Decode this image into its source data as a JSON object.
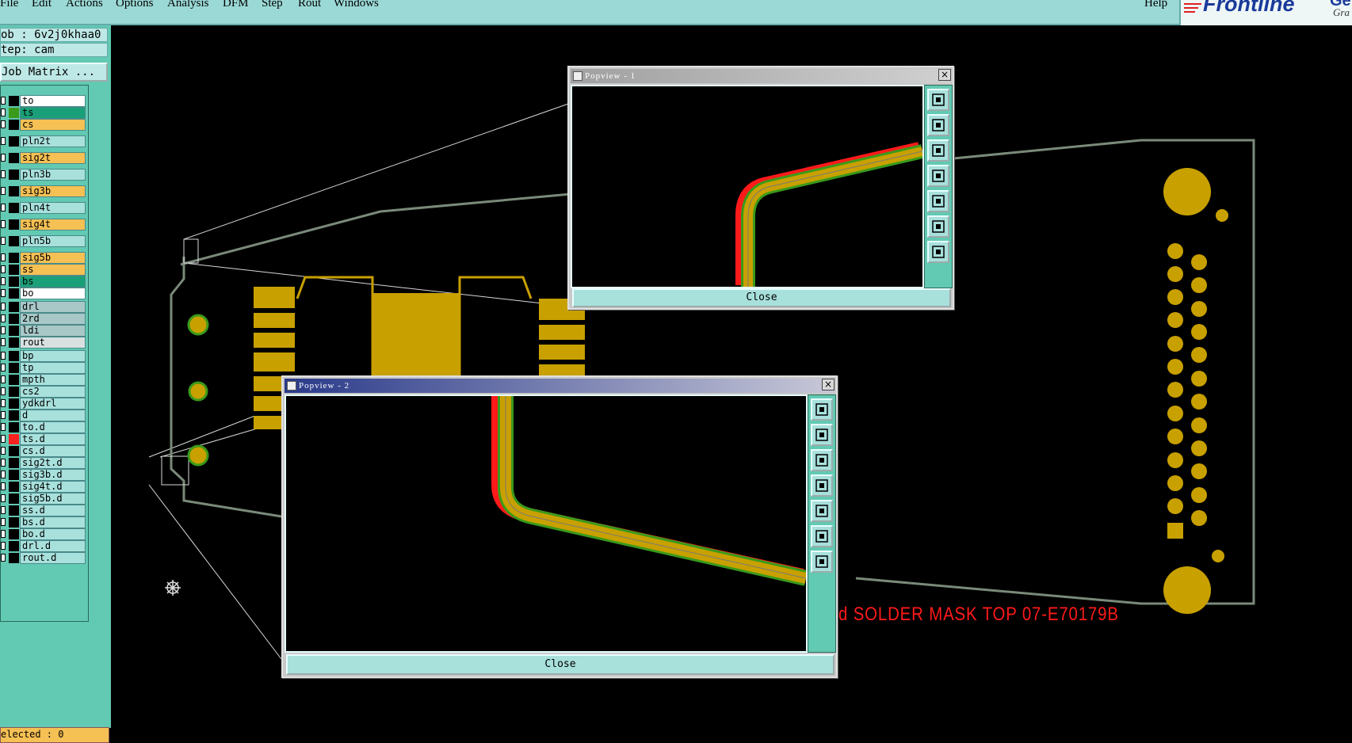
{
  "menu": {
    "file": "File",
    "edit": "Edit",
    "actions": "Actions",
    "options": "Options",
    "analysis": "Analysis",
    "dfm": "DFM",
    "step": "Step",
    "rout": "Rout",
    "windows": "Windows",
    "help": "Help"
  },
  "logo": {
    "brand": "Frontline",
    "extra": "Gei",
    "sub": "Gra"
  },
  "job": {
    "job_line": "ob : 6v2j0khaa0",
    "step_line": "tep: cam",
    "matrix_button": "Job Matrix ..."
  },
  "layers": [
    {
      "name": "to",
      "color": "#ffffff",
      "swatch": "#000000"
    },
    {
      "name": "ts",
      "color": "#1aa078",
      "swatch": "#3a9a1a"
    },
    {
      "name": "cs",
      "color": "#f5c054",
      "swatch": "#000000"
    },
    {
      "name": "pln2t",
      "color": "#a8e0dc",
      "swatch": "#000000"
    },
    {
      "name": "sig2t",
      "color": "#f5c054",
      "swatch": "#000000"
    },
    {
      "name": "pln3b",
      "color": "#a8e0dc",
      "swatch": "#000000"
    },
    {
      "name": "sig3b",
      "color": "#f5c054",
      "swatch": "#000000"
    },
    {
      "name": "pln4t",
      "color": "#a8e0dc",
      "swatch": "#000000"
    },
    {
      "name": "sig4t",
      "color": "#f5c054",
      "swatch": "#000000"
    },
    {
      "name": "pln5b",
      "color": "#a8e0dc",
      "swatch": "#000000"
    },
    {
      "name": "sig5b",
      "color": "#f5c054",
      "swatch": "#000000"
    },
    {
      "name": "ss",
      "color": "#f5c054",
      "swatch": "#000000"
    },
    {
      "name": "bs",
      "color": "#1aa078",
      "swatch": "#000000"
    },
    {
      "name": "bo",
      "color": "#ffffff",
      "swatch": "#000000"
    },
    {
      "name": "drl",
      "color": "#a8c8c8",
      "swatch": "#000000"
    },
    {
      "name": "2rd",
      "color": "#a8c8c8",
      "swatch": "#000000"
    },
    {
      "name": "ldi",
      "color": "#a8c8c8",
      "swatch": "#000000"
    },
    {
      "name": "rout",
      "color": "#d8e0e0",
      "swatch": "#000000"
    },
    {
      "name": "bp",
      "color": "#a8e0dc",
      "swatch": "#000000"
    },
    {
      "name": "tp",
      "color": "#a8e0dc",
      "swatch": "#000000"
    },
    {
      "name": "mpth",
      "color": "#a8e0dc",
      "swatch": "#000000"
    },
    {
      "name": "cs2",
      "color": "#a8e0dc",
      "swatch": "#000000"
    },
    {
      "name": "ydkdrl",
      "color": "#a8e0dc",
      "swatch": "#000000"
    },
    {
      "name": "d",
      "color": "#a8e0dc",
      "swatch": "#000000"
    },
    {
      "name": "to.d",
      "color": "#a8e0dc",
      "swatch": "#000000"
    },
    {
      "name": "ts.d",
      "color": "#a8e0dc",
      "swatch": "#ff2020"
    },
    {
      "name": "cs.d",
      "color": "#a8e0dc",
      "swatch": "#000000"
    },
    {
      "name": "sig2t.d",
      "color": "#a8e0dc",
      "swatch": "#000000"
    },
    {
      "name": "sig3b.d",
      "color": "#a8e0dc",
      "swatch": "#000000"
    },
    {
      "name": "sig4t.d",
      "color": "#a8e0dc",
      "swatch": "#000000"
    },
    {
      "name": "sig5b.d",
      "color": "#a8e0dc",
      "swatch": "#000000"
    },
    {
      "name": "ss.d",
      "color": "#a8e0dc",
      "swatch": "#000000"
    },
    {
      "name": "bs.d",
      "color": "#a8e0dc",
      "swatch": "#000000"
    },
    {
      "name": "bo.d",
      "color": "#a8e0dc",
      "swatch": "#000000"
    },
    {
      "name": "drl.d",
      "color": "#a8e0dc",
      "swatch": "#000000"
    },
    {
      "name": "rout.d",
      "color": "#a8e0dc",
      "swatch": "#000000"
    }
  ],
  "status": {
    "selected": "elected : 0"
  },
  "popview1": {
    "title": "Popview - 1",
    "close_x": "×",
    "close_label": "Close"
  },
  "popview2": {
    "title": "Popview - 2",
    "close_x": "×",
    "close_label": "Close"
  },
  "annotation": {
    "text": "d SOLDER MASK TOP 07-E70179B"
  },
  "colors": {
    "copper": "#c8a000",
    "board_outline": "#7a8a7a",
    "trace_green": "#3a9a1a",
    "trace_red": "#ff1a1a",
    "menubar": "#9bd9d6",
    "panel": "#62c9b2"
  }
}
